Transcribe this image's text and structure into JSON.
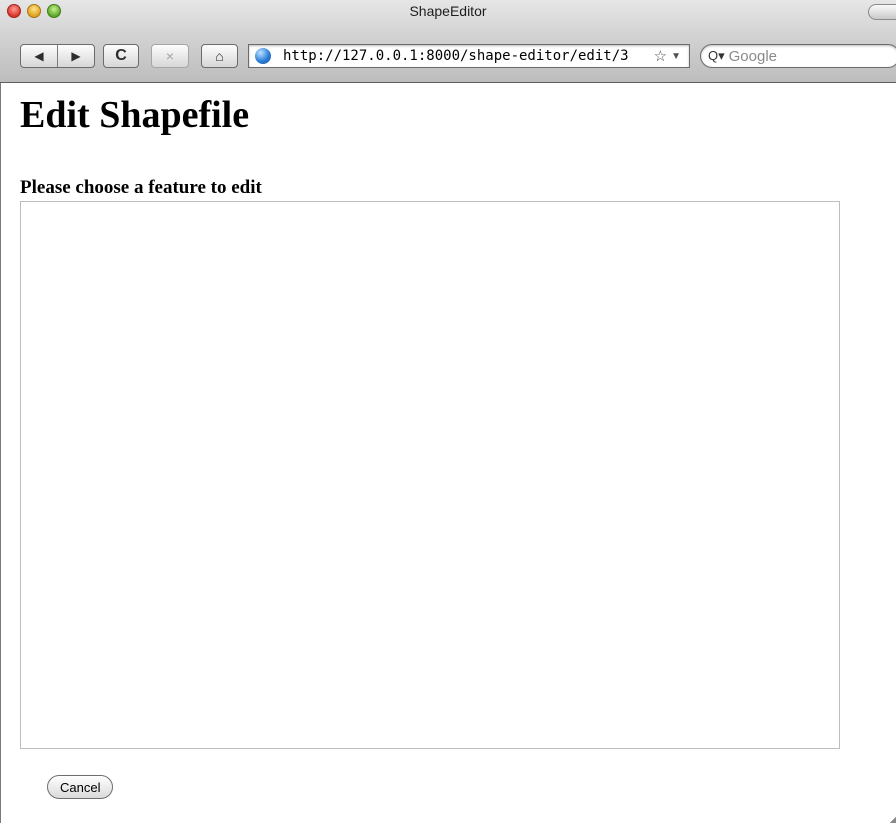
{
  "window": {
    "title": "ShapeEditor"
  },
  "toolbar": {
    "back_icon": "◀",
    "forward_icon": "▶",
    "reload_icon": "C",
    "stop_icon": "×",
    "home_icon": "⌂",
    "url": "http://127.0.0.1:8000/shape-editor/edit/3",
    "bookmark_icon": "☆",
    "dropdown_icon": "▼",
    "search_icon": "Q▾",
    "search_placeholder": "Google"
  },
  "page": {
    "heading": "Edit Shapefile",
    "prompt": "Please choose a feature to edit",
    "cancel_label": "Cancel"
  }
}
